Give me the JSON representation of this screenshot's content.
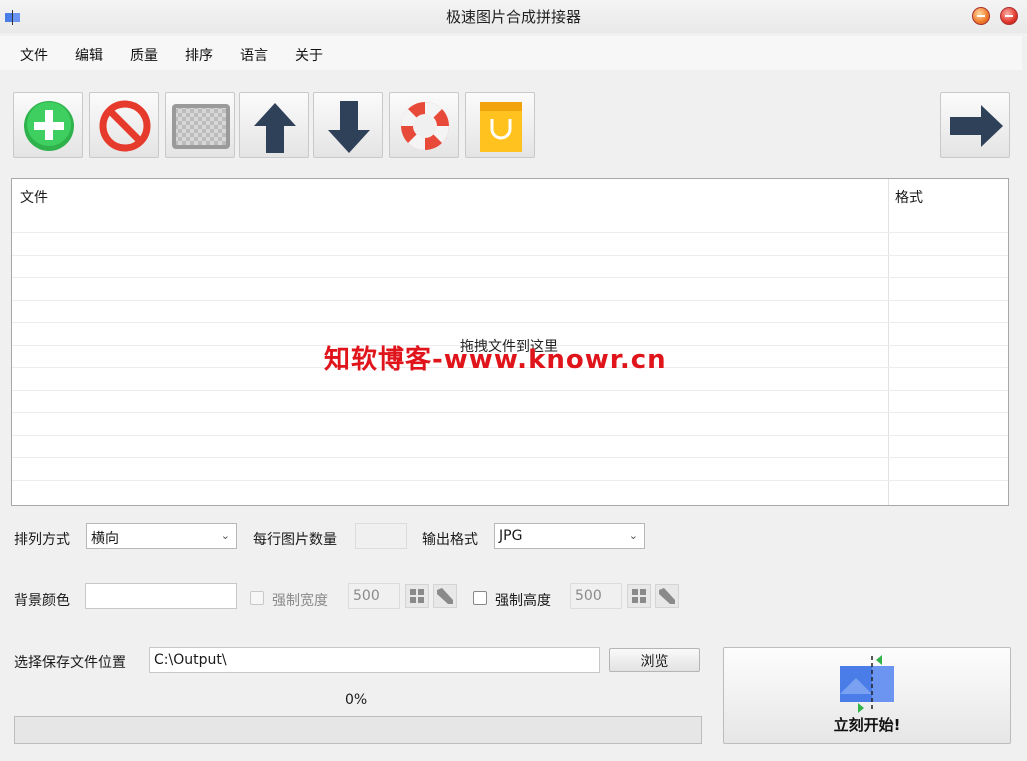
{
  "window": {
    "title": "极速图片合成拼接器"
  },
  "menu": [
    "文件",
    "编辑",
    "质量",
    "排序",
    "语言",
    "关于"
  ],
  "toolbar": [
    {
      "name": "add-button",
      "icon": "plus-circle-icon"
    },
    {
      "name": "remove-button",
      "icon": "prohibited-icon"
    },
    {
      "name": "clear-button",
      "icon": "checkerboard-icon"
    },
    {
      "name": "move-up-button",
      "icon": "arrow-up-icon"
    },
    {
      "name": "move-down-button",
      "icon": "arrow-down-icon"
    },
    {
      "name": "help-button",
      "icon": "lifebuoy-icon"
    },
    {
      "name": "shop-button",
      "icon": "shopping-bag-icon"
    },
    {
      "name": "next-button",
      "icon": "arrow-right-icon"
    }
  ],
  "filelist": {
    "columns": [
      "文件",
      "格式"
    ],
    "drop_hint": "拖拽文件到这里",
    "watermark": "知软博客-www.knowr.cn"
  },
  "options": {
    "arrange_label": "排列方式",
    "arrange_value": "横向",
    "per_row_label": "每行图片数量",
    "per_row_value": "",
    "format_label": "输出格式",
    "format_value": "JPG",
    "bg_label": "背景颜色",
    "force_width_label": "强制宽度",
    "force_width_value": "500",
    "force_height_label": "强制高度",
    "force_height_value": "500"
  },
  "output": {
    "label": "选择保存文件位置",
    "path": "C:\\Output\\",
    "browse_label": "浏览",
    "progress_text": "0%",
    "progress": 0
  },
  "start": {
    "label": "立刻开始!"
  },
  "colors": {
    "accent": "#3a9be0",
    "watermark": "#e0141b"
  }
}
